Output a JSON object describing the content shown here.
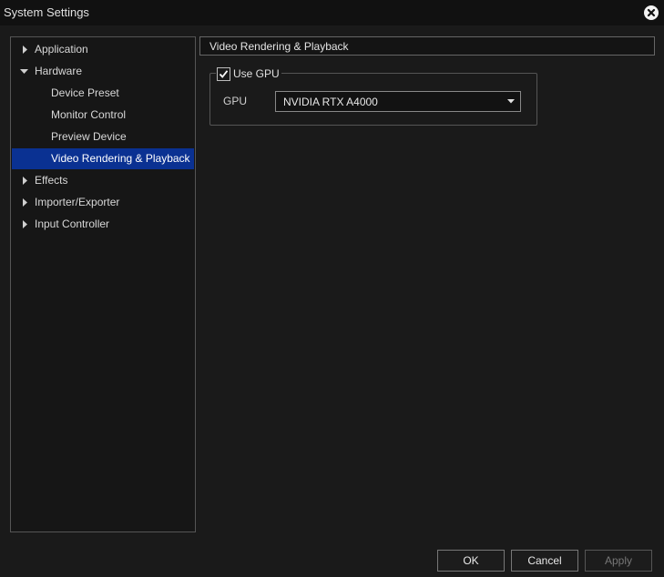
{
  "window": {
    "title": "System Settings"
  },
  "tree": {
    "items": [
      {
        "label": "Application",
        "expandable": true,
        "expanded": false,
        "level": 0
      },
      {
        "label": "Hardware",
        "expandable": true,
        "expanded": true,
        "level": 0
      },
      {
        "label": "Device Preset",
        "level": 1
      },
      {
        "label": "Monitor Control",
        "level": 1
      },
      {
        "label": "Preview Device",
        "level": 1
      },
      {
        "label": "Video Rendering & Playback",
        "level": 1,
        "selected": true
      },
      {
        "label": "Effects",
        "expandable": true,
        "expanded": false,
        "level": 0
      },
      {
        "label": "Importer/Exporter",
        "expandable": true,
        "expanded": false,
        "level": 0
      },
      {
        "label": "Input Controller",
        "expandable": true,
        "expanded": false,
        "level": 0
      }
    ]
  },
  "panel": {
    "header": "Video Rendering & Playback",
    "use_gpu": {
      "label": "Use GPU",
      "checked": true
    },
    "gpu": {
      "label": "GPU",
      "selected": "NVIDIA RTX A4000"
    }
  },
  "buttons": {
    "ok": "OK",
    "cancel": "Cancel",
    "apply": "Apply"
  },
  "colors": {
    "selection": "#0a3192",
    "background": "#1a1a1a"
  }
}
